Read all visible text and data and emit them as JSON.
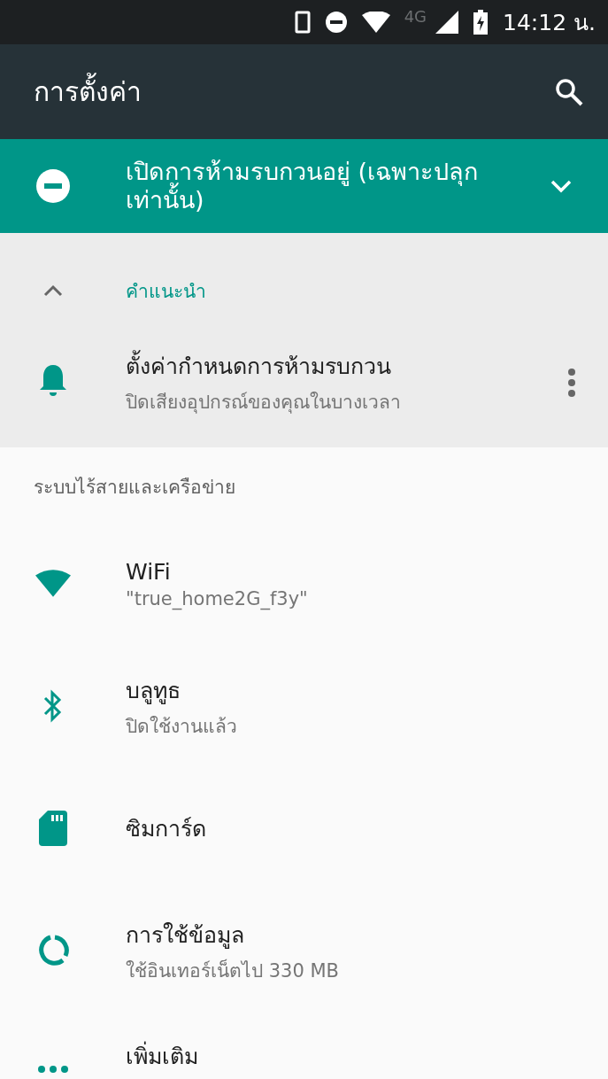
{
  "status_bar": {
    "network": "4G",
    "time": "14:12 น."
  },
  "toolbar": {
    "title": "การตั้งค่า"
  },
  "dnd_banner": {
    "text": "เปิดการห้ามรบกวนอยู่ (เฉพาะปลุกเท่านั้น)",
    "expanded": false
  },
  "suggestions": {
    "header": "คำแนะนำ",
    "expanded": true,
    "items": [
      {
        "title": "ตั้งค่ากำหนดการห้ามรบกวน",
        "summary": "ปิดเสียงอุปกรณ์ของคุณในบางเวลา"
      }
    ]
  },
  "section": {
    "title": "ระบบไร้สายและเครือข่าย"
  },
  "items": [
    {
      "kind": "wifi",
      "title": "WiFi",
      "summary": "\"true_home2G_f3y\""
    },
    {
      "kind": "bluetooth",
      "title": "บลูทูธ",
      "summary": "ปิดใช้งานแล้ว"
    },
    {
      "kind": "sim",
      "title": "ซิมการ์ด"
    },
    {
      "kind": "data",
      "title": "การใช้ข้อมูล",
      "summary": "ใช้อินเทอร์เน็ตไป 330 MB"
    },
    {
      "kind": "more",
      "title": "เพิ่มเติม"
    }
  ]
}
